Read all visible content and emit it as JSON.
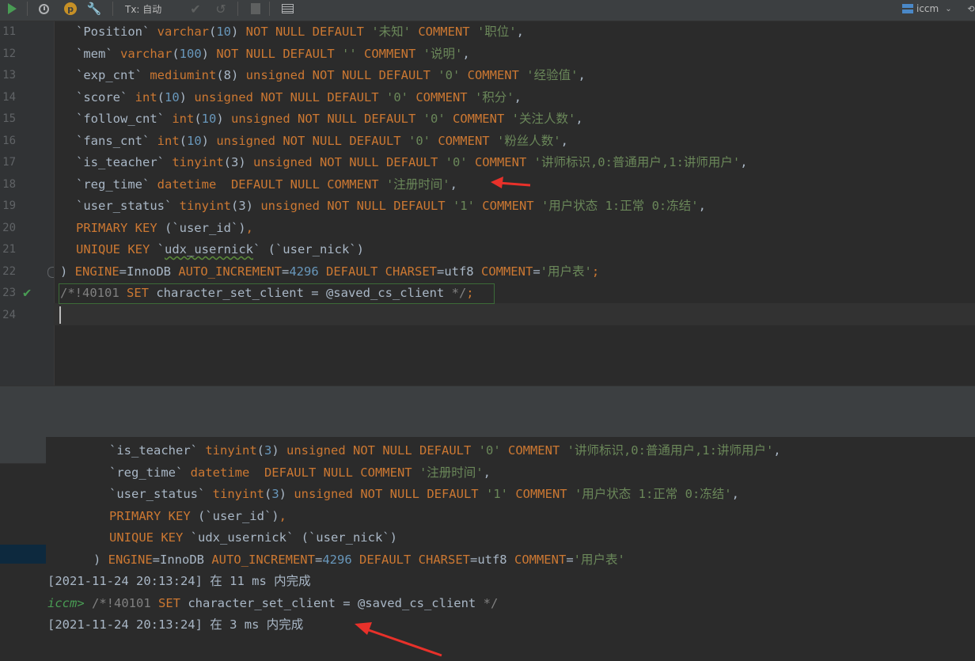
{
  "toolbar": {
    "tx_label": "Tx: 自动",
    "p_badge": "p",
    "connection": "iccm"
  },
  "editor": {
    "line_numbers": [
      "11",
      "12",
      "13",
      "14",
      "15",
      "16",
      "17",
      "18",
      "19",
      "20",
      "21",
      "22",
      "23",
      "24"
    ],
    "lines": [
      [
        [
          "`Position` ",
          "t"
        ],
        [
          "varchar",
          "k"
        ],
        [
          "(",
          "t"
        ],
        [
          "10",
          "f"
        ],
        [
          ") ",
          "t"
        ],
        [
          "NOT NULL DEFAULT ",
          "k"
        ],
        [
          "'未知' ",
          "s"
        ],
        [
          "COMMENT ",
          "k"
        ],
        [
          "'职位'",
          "s"
        ],
        [
          ",",
          "t"
        ]
      ],
      [
        [
          "`mem` ",
          "t"
        ],
        [
          "varchar",
          "k"
        ],
        [
          "(",
          "t"
        ],
        [
          "100",
          "f"
        ],
        [
          ") ",
          "t"
        ],
        [
          "NOT NULL DEFAULT ",
          "k"
        ],
        [
          "'' ",
          "s"
        ],
        [
          "COMMENT ",
          "k"
        ],
        [
          "'说明'",
          "s"
        ],
        [
          ",",
          "t"
        ]
      ],
      [
        [
          "`exp_cnt` ",
          "t"
        ],
        [
          "mediumint",
          "k"
        ],
        [
          "(8) ",
          "t"
        ],
        [
          "unsigned NOT NULL DEFAULT ",
          "k"
        ],
        [
          "'0' ",
          "s"
        ],
        [
          "COMMENT ",
          "k"
        ],
        [
          "'经验值'",
          "s"
        ],
        [
          ",",
          "t"
        ]
      ],
      [
        [
          "`score` ",
          "t"
        ],
        [
          "int",
          "k"
        ],
        [
          "(",
          "t"
        ],
        [
          "10",
          "f"
        ],
        [
          ") ",
          "t"
        ],
        [
          "unsigned NOT NULL DEFAULT ",
          "k"
        ],
        [
          "'0' ",
          "s"
        ],
        [
          "COMMENT ",
          "k"
        ],
        [
          "'积分'",
          "s"
        ],
        [
          ",",
          "t"
        ]
      ],
      [
        [
          "`follow_cnt` ",
          "t"
        ],
        [
          "int",
          "k"
        ],
        [
          "(",
          "t"
        ],
        [
          "10",
          "f"
        ],
        [
          ") ",
          "t"
        ],
        [
          "unsigned NOT NULL DEFAULT ",
          "k"
        ],
        [
          "'0' ",
          "s"
        ],
        [
          "COMMENT ",
          "k"
        ],
        [
          "'关注人数'",
          "s"
        ],
        [
          ",",
          "t"
        ]
      ],
      [
        [
          "`fans_cnt` ",
          "t"
        ],
        [
          "int",
          "k"
        ],
        [
          "(",
          "t"
        ],
        [
          "10",
          "f"
        ],
        [
          ") ",
          "t"
        ],
        [
          "unsigned NOT NULL DEFAULT ",
          "k"
        ],
        [
          "'0' ",
          "s"
        ],
        [
          "COMMENT ",
          "k"
        ],
        [
          "'粉丝人数'",
          "s"
        ],
        [
          ",",
          "t"
        ]
      ],
      [
        [
          "`is_teacher` ",
          "t"
        ],
        [
          "tinyint",
          "k"
        ],
        [
          "(3) ",
          "t"
        ],
        [
          "unsigned NOT NULL DEFAULT ",
          "k"
        ],
        [
          "'0' ",
          "s"
        ],
        [
          "COMMENT ",
          "k"
        ],
        [
          "'讲师标识,0:普通用户,1:讲师用户'",
          "s"
        ],
        [
          ",",
          "t"
        ]
      ],
      [
        [
          "`reg_time` ",
          "t"
        ],
        [
          "datetime  DEFAULT NULL COMMENT ",
          "k"
        ],
        [
          "'注册时间'",
          "s"
        ],
        [
          ",",
          "t"
        ]
      ],
      [
        [
          "`user_status` ",
          "t"
        ],
        [
          "tinyint",
          "k"
        ],
        [
          "(3) ",
          "t"
        ],
        [
          "unsigned NOT NULL DEFAULT ",
          "k"
        ],
        [
          "'1' ",
          "s"
        ],
        [
          "COMMENT ",
          "k"
        ],
        [
          "'用户状态 1:正常 0:冻结'",
          "s"
        ],
        [
          ",",
          "t"
        ]
      ],
      [
        [
          "PRIMARY KEY ",
          "k"
        ],
        [
          "(`user_id`)",
          "t"
        ],
        [
          ",",
          "k"
        ]
      ],
      [
        [
          "UNIQUE KEY ",
          "k"
        ],
        [
          "`",
          "t"
        ],
        [
          "udx_usernick",
          "q"
        ],
        [
          "` (`user_nick`)",
          "t"
        ]
      ],
      [
        [
          ") ",
          "t"
        ],
        [
          "ENGINE",
          "k"
        ],
        [
          "=InnoDB ",
          "t"
        ],
        [
          "AUTO_INCREMENT",
          "k"
        ],
        [
          "=",
          "t"
        ],
        [
          "4296 ",
          "f"
        ],
        [
          "DEFAULT CHARSET",
          "k"
        ],
        [
          "=utf8 ",
          "t"
        ],
        [
          "COMMENT",
          "k"
        ],
        [
          "=",
          "t"
        ],
        [
          "'用户表'",
          "s"
        ],
        [
          ";",
          "k"
        ]
      ],
      [
        [
          "/*!40101 ",
          "c"
        ],
        [
          "SET ",
          "k"
        ],
        [
          "character_set_client = @saved_cs_client ",
          "t"
        ],
        [
          "*/",
          "c"
        ],
        [
          ";",
          "k"
        ]
      ],
      []
    ]
  },
  "console": {
    "lines": [
      [
        [
          "`is_teacher` ",
          "t"
        ],
        [
          "tinyint",
          "k"
        ],
        [
          "(",
          "t"
        ],
        [
          "3",
          "f"
        ],
        [
          ") ",
          "t"
        ],
        [
          "unsigned NOT NULL DEFAULT ",
          "k"
        ],
        [
          "'0' ",
          "s"
        ],
        [
          "COMMENT ",
          "k"
        ],
        [
          "'讲师标识,0:普通用户,1:讲师用户'",
          "s"
        ],
        [
          ",",
          "t"
        ]
      ],
      [
        [
          "`reg_time` ",
          "t"
        ],
        [
          "datetime  DEFAULT NULL COMMENT ",
          "k"
        ],
        [
          "'注册时间'",
          "s"
        ],
        [
          ",",
          "t"
        ]
      ],
      [
        [
          "`user_status` ",
          "t"
        ],
        [
          "tinyint",
          "k"
        ],
        [
          "(",
          "t"
        ],
        [
          "3",
          "f"
        ],
        [
          ") ",
          "t"
        ],
        [
          "unsigned NOT NULL DEFAULT ",
          "k"
        ],
        [
          "'1' ",
          "s"
        ],
        [
          "COMMENT ",
          "k"
        ],
        [
          "'用户状态 1:正常 0:冻结'",
          "s"
        ],
        [
          ",",
          "t"
        ]
      ],
      [
        [
          "PRIMARY KEY ",
          "k"
        ],
        [
          "(`user_id`)",
          "t"
        ],
        [
          ",",
          "k"
        ]
      ],
      [
        [
          "UNIQUE KEY ",
          "k"
        ],
        [
          "`udx_usernick` (`user_nick`)",
          "t"
        ]
      ],
      [
        [
          ") ",
          "t"
        ],
        [
          "ENGINE",
          "k"
        ],
        [
          "=InnoDB ",
          "t"
        ],
        [
          "AUTO_INCREMENT",
          "k"
        ],
        [
          "=",
          "t"
        ],
        [
          "4296 ",
          "f"
        ],
        [
          "DEFAULT CHARSET",
          "k"
        ],
        [
          "=utf8 ",
          "t"
        ],
        [
          "COMMENT",
          "k"
        ],
        [
          "=",
          "t"
        ],
        [
          "'用户表'",
          "s"
        ]
      ],
      [
        [
          "[2021-11-24 20:13:24] 在 11 ms 内完成",
          "t"
        ]
      ],
      [
        [
          "iccm> ",
          "p"
        ],
        [
          "/*!40101 ",
          "c"
        ],
        [
          "SET ",
          "k"
        ],
        [
          "character_set_client = @saved_cs_client ",
          "t"
        ],
        [
          "*/",
          "c"
        ]
      ],
      [
        [
          "[2021-11-24 20:13:24] 在 3 ms 内完成",
          "t"
        ]
      ]
    ]
  },
  "colors": {
    "background": "#2b2b2b",
    "keyword": "#cc7832",
    "number": "#6897bb",
    "string": "#6a8759",
    "comment": "#808080",
    "text": "#a9b7c6",
    "success": "#499c54",
    "annotation_arrow": "#e8312a"
  }
}
